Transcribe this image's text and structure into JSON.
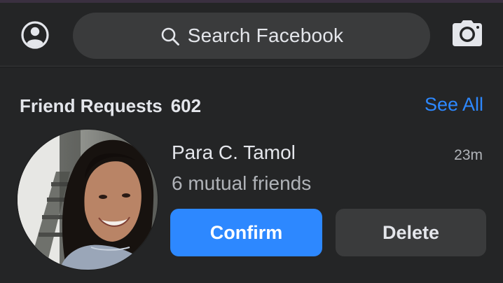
{
  "header": {
    "profile_icon": "user-circle-icon",
    "search_icon": "search-icon",
    "search_placeholder": "Search Facebook",
    "camera_icon": "camera-icon"
  },
  "friend_requests": {
    "title": "Friend Requests",
    "count": "602",
    "see_all_label": "See All",
    "items": [
      {
        "name": "Para C. Tamol",
        "time": "23m",
        "mutual": "6 mutual friends",
        "confirm_label": "Confirm",
        "delete_label": "Delete"
      }
    ]
  },
  "colors": {
    "background": "#18191a",
    "surface": "#242526",
    "input": "#3a3b3c",
    "accent": "#2d88ff",
    "text_primary": "#e4e6eb",
    "text_secondary": "#b0b3b8"
  }
}
